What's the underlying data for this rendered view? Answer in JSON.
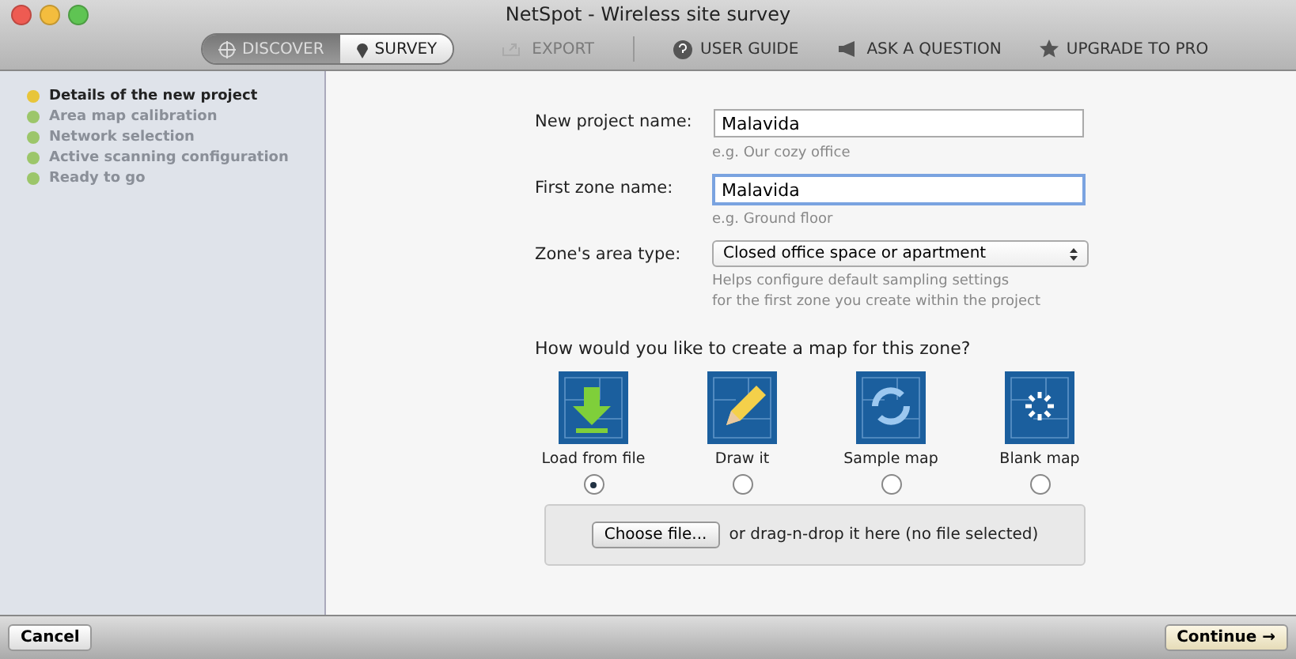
{
  "window": {
    "title": "NetSpot - Wireless site survey"
  },
  "modes": [
    {
      "label": "DISCOVER",
      "kind": "discover",
      "selected": false
    },
    {
      "label": "SURVEY",
      "kind": "survey",
      "selected": true
    }
  ],
  "toolbar": [
    {
      "label": "EXPORT",
      "kind": "export",
      "disabled": true
    },
    {
      "label": "USER GUIDE",
      "kind": "help",
      "disabled": false
    },
    {
      "label": "ASK A QUESTION",
      "kind": "megaphone",
      "disabled": false
    },
    {
      "label": "UPGRADE TO PRO",
      "kind": "star",
      "disabled": false
    }
  ],
  "steps": [
    {
      "label": "Details of the new project",
      "color": "#e8c53a",
      "selected": true
    },
    {
      "label": "Area map calibration",
      "color": "#9cc66a",
      "selected": false
    },
    {
      "label": "Network selection",
      "color": "#9cc66a",
      "selected": false
    },
    {
      "label": "Active scanning configuration",
      "color": "#9cc66a",
      "selected": false
    },
    {
      "label": "Ready to go",
      "color": "#9cc66a",
      "selected": false
    }
  ],
  "form": [
    {
      "label": "New project name:",
      "kind": "text",
      "value": "Malavida",
      "hint": "e.g. Our cozy office",
      "focused": false
    },
    {
      "label": "First zone name:",
      "kind": "text",
      "value": "Malavida",
      "hint": "e.g. Ground floor",
      "focused": true
    },
    {
      "label": "Zone's area type:",
      "kind": "select",
      "value": "Closed office space or apartment",
      "hint": "Helps configure default sampling settings\nfor the first zone you create within the project"
    }
  ],
  "map_question": "How would you like to create a map for this zone?",
  "map_options": [
    {
      "label": "Load from file",
      "kind": "load",
      "selected": true
    },
    {
      "label": "Draw it",
      "kind": "draw",
      "selected": false
    },
    {
      "label": "Sample map",
      "kind": "sample",
      "selected": false
    },
    {
      "label": "Blank map",
      "kind": "blank",
      "selected": false
    }
  ],
  "file_drop": {
    "button": "Choose file...",
    "text": "or drag-n-drop it here (no file selected)"
  },
  "footer": {
    "cancel": "Cancel",
    "continue": "Continue →"
  }
}
